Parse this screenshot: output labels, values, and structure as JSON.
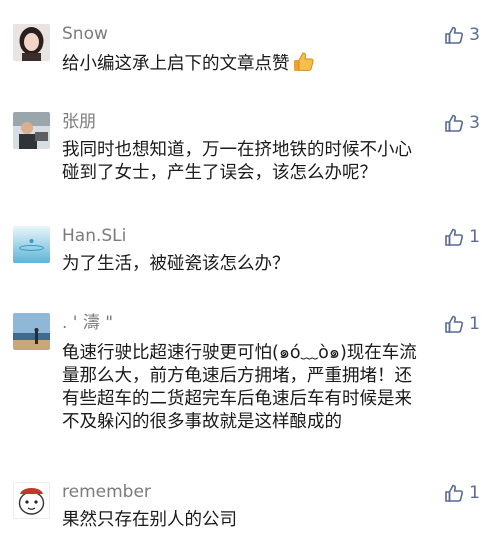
{
  "colors": {
    "username": "#7b7b7b",
    "like": "#576b95",
    "text": "#1a1a1a",
    "background": "#ffffff"
  },
  "comments": [
    {
      "user": "Snow",
      "likes": "3",
      "liked": true,
      "text_lines": [
        "给小编这承上启下的文章点赞"
      ],
      "emoji": "thumbs-up-emoji"
    },
    {
      "user": "张朋",
      "likes": "3",
      "liked": true,
      "text_lines": [
        "我同时也想知道，万一在挤地铁的时候不小心",
        "碰到了女士，产生了误会，该怎么办呢？"
      ]
    },
    {
      "user": "Han.SLi",
      "likes": "1",
      "liked": false,
      "text_lines": [
        "为了生活，被碰瓷该怎么办？"
      ]
    },
    {
      "user": ". ' 濤 \"",
      "likes": "1",
      "liked": false,
      "text_lines": [
        "龟速行驶比超速行驶更可怕(๑ó﹏ò๑)现在车流",
        "量那么大，前方龟速后方拥堵，严重拥堵！还",
        "有些超车的二货超完车后龟速后车有时候是来",
        "不及躲闪的很多事故就是这样酿成的"
      ]
    },
    {
      "user": "remember",
      "likes": "1",
      "liked": false,
      "text_lines": [
        "果然只存在别人的公司"
      ]
    }
  ]
}
